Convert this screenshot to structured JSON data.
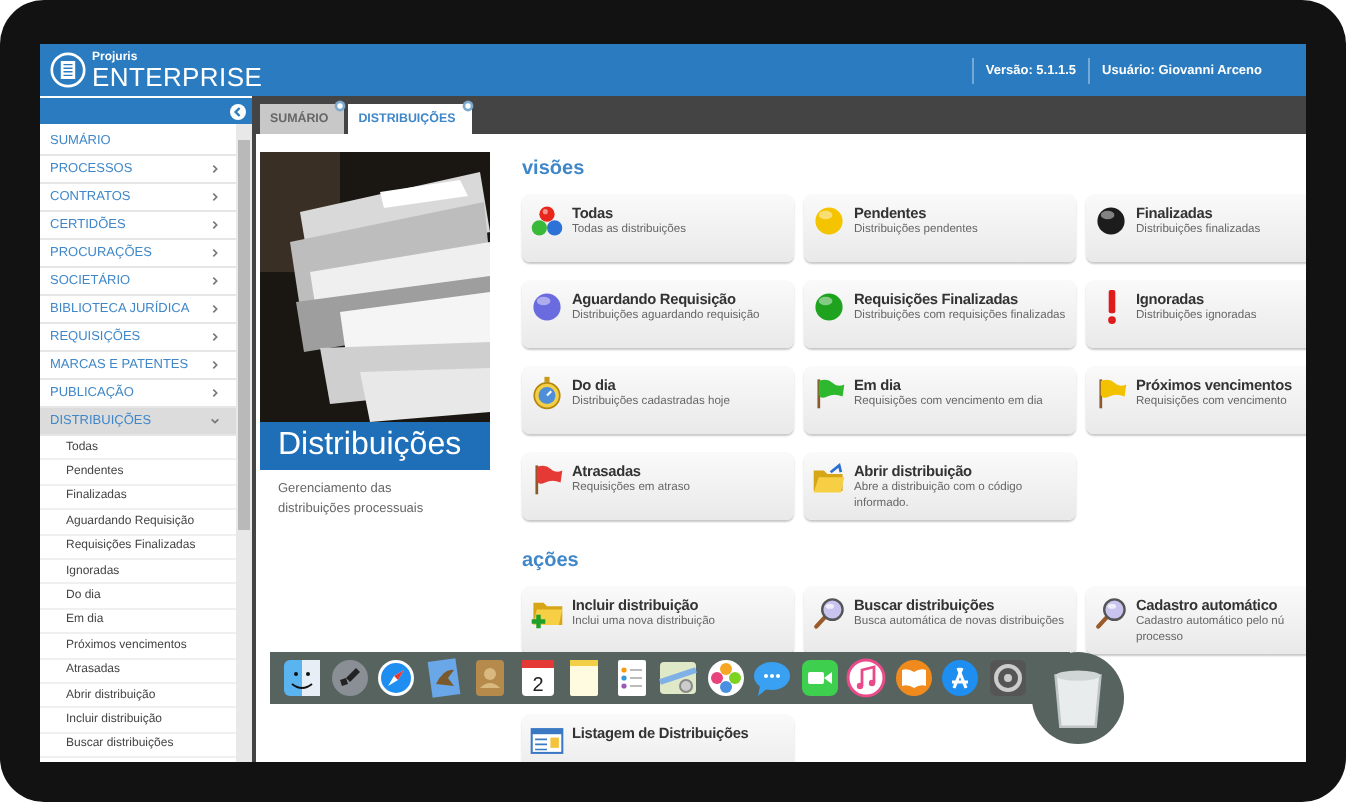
{
  "header": {
    "brand_small": "Projuris",
    "brand_large": "ENTERPRISE",
    "version": "Versão: 5.1.1.5",
    "user": "Usuário: Giovanni Arceno"
  },
  "sidebar": {
    "items": [
      {
        "label": "SUMÁRIO",
        "kind": "link"
      },
      {
        "label": "PROCESSOS",
        "kind": "group",
        "expanded": false
      },
      {
        "label": "CONTRATOS",
        "kind": "group",
        "expanded": false
      },
      {
        "label": "CERTIDÕES",
        "kind": "group",
        "expanded": false
      },
      {
        "label": "PROCURAÇÕES",
        "kind": "group",
        "expanded": false
      },
      {
        "label": "SOCIETÁRIO",
        "kind": "group",
        "expanded": false
      },
      {
        "label": "BIBLIOTECA JURÍDICA",
        "kind": "group",
        "expanded": false
      },
      {
        "label": "REQUISIÇÕES",
        "kind": "group",
        "expanded": false
      },
      {
        "label": "MARCAS E PATENTES",
        "kind": "group",
        "expanded": false
      },
      {
        "label": "PUBLICAÇÃO",
        "kind": "group",
        "expanded": false
      },
      {
        "label": "DISTRIBUIÇÕES",
        "kind": "group",
        "expanded": true,
        "children": [
          {
            "label": "Todas"
          },
          {
            "label": "Pendentes"
          },
          {
            "label": "Finalizadas"
          },
          {
            "label": "Aguardando Requisição"
          },
          {
            "label": "Requisições Finalizadas"
          },
          {
            "label": "Ignoradas"
          },
          {
            "label": "Do dia"
          },
          {
            "label": "Em dia"
          },
          {
            "label": "Próximos vencimentos"
          },
          {
            "label": "Atrasadas"
          },
          {
            "label": "Abrir distribuição"
          },
          {
            "label": "Incluir distribuição"
          },
          {
            "label": "Buscar distribuições"
          }
        ]
      }
    ]
  },
  "tabs": [
    {
      "label": "SUMÁRIO",
      "selected": false
    },
    {
      "label": "DISTRIBUIÇÕES",
      "selected": true
    }
  ],
  "intro": {
    "title": "Distribuições",
    "description": "Gerenciamento das distribuições processuais"
  },
  "sections": [
    {
      "heading": "visões",
      "cards": [
        {
          "kind": "balls",
          "title": "Todas",
          "subtitle": "Todas as distribuições"
        },
        {
          "kind": "ball",
          "color": "#f5c400",
          "title": "Pendentes",
          "subtitle": "Distribuições pendentes"
        },
        {
          "kind": "ball",
          "color": "#1c1c1c",
          "title": "Finalizadas",
          "subtitle": "Distribuições finalizadas"
        },
        {
          "kind": "ball",
          "color": "#6b6be0",
          "title": "Aguardando Requisição",
          "subtitle": "Distribuições aguardando requisição"
        },
        {
          "kind": "ball",
          "color": "#1fa31f",
          "title": "Requisições Finalizadas",
          "subtitle": "Distribuições com requisições finalizadas"
        },
        {
          "kind": "exclamation",
          "title": "Ignoradas",
          "subtitle": "Distribuições ignoradas"
        },
        {
          "kind": "stopwatch",
          "title": "Do dia",
          "subtitle": "Distribuições cadastradas hoje"
        },
        {
          "kind": "flag",
          "color": "#2eb82e",
          "title": "Em dia",
          "subtitle": "Requisições com vencimento em dia"
        },
        {
          "kind": "flag",
          "color": "#f2c200",
          "title": "Próximos vencimentos",
          "subtitle": "Requisições com vencimento"
        },
        {
          "kind": "flag",
          "color": "#e53935",
          "title": "Atrasadas",
          "subtitle": "Requisições em atraso"
        },
        {
          "kind": "folder-open",
          "title": "Abrir distribuição",
          "subtitle": "Abre a distribuição com o código informado."
        }
      ]
    },
    {
      "heading": "ações",
      "cards": [
        {
          "kind": "folder-plus",
          "title": "Incluir distribuição",
          "subtitle": "Inclui uma nova distribuição"
        },
        {
          "kind": "magnifier",
          "title": "Buscar distribuições",
          "subtitle": "Busca automática de novas distribuições"
        },
        {
          "kind": "magnifier",
          "title": "Cadastro automático",
          "subtitle": "Cadastro automático pelo nú\nprocesso"
        },
        {
          "kind": "list-window",
          "title": "Listagem de Distribuições"
        }
      ]
    }
  ],
  "dock": {
    "items": [
      {
        "kind": "finder"
      },
      {
        "kind": "launchpad"
      },
      {
        "kind": "safari"
      },
      {
        "kind": "mail"
      },
      {
        "kind": "contacts"
      },
      {
        "kind": "calendar",
        "label": "2"
      },
      {
        "kind": "notes"
      },
      {
        "kind": "reminders"
      },
      {
        "kind": "maps"
      },
      {
        "kind": "photos"
      },
      {
        "kind": "messages"
      },
      {
        "kind": "facetime"
      },
      {
        "kind": "music"
      },
      {
        "kind": "books"
      },
      {
        "kind": "appstore"
      },
      {
        "kind": "settings"
      },
      {
        "kind": "trash"
      }
    ]
  }
}
